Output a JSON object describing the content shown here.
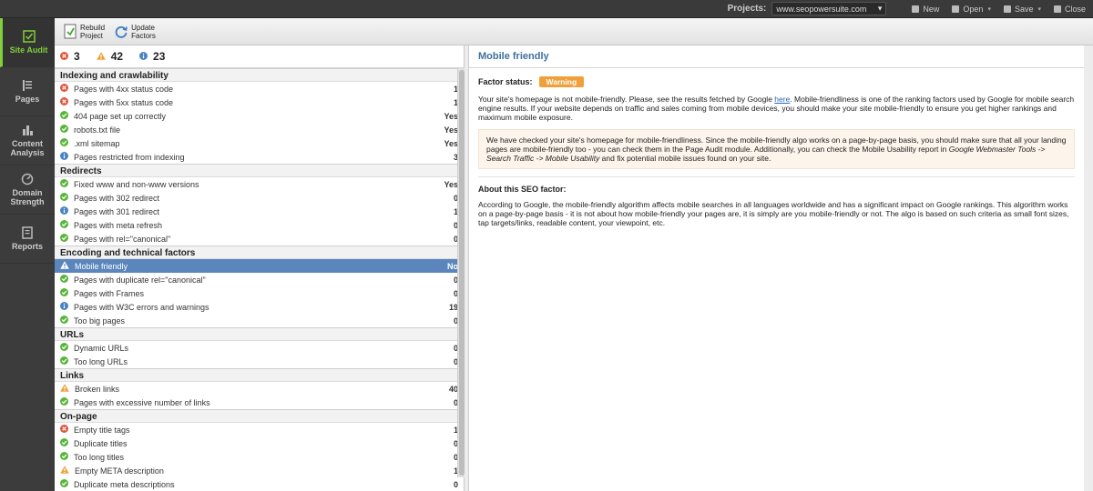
{
  "topbar": {
    "projects_label": "Projects:",
    "project_value": "www.seopowersuite.com",
    "new_label": "New",
    "open_label": "Open",
    "save_label": "Save",
    "close_label": "Close"
  },
  "sidebar": {
    "items": [
      {
        "label": "Site Audit"
      },
      {
        "label": "Pages"
      },
      {
        "label": "Content Analysis"
      },
      {
        "label": "Domain Strength"
      },
      {
        "label": "Reports"
      }
    ]
  },
  "toolbar": {
    "rebuild_line1": "Rebuild",
    "rebuild_line2": "Project",
    "update_line1": "Update",
    "update_line2": "Factors"
  },
  "summary": {
    "errors": "3",
    "warnings": "42",
    "info": "23"
  },
  "groups": [
    {
      "title": "Indexing and crawlability",
      "rows": [
        {
          "status": "error",
          "label": "Pages with 4xx status code",
          "value": "1"
        },
        {
          "status": "error",
          "label": "Pages with 5xx status code",
          "value": "1"
        },
        {
          "status": "ok",
          "label": "404 page set up correctly",
          "value": "Yes"
        },
        {
          "status": "ok",
          "label": "robots.txt file",
          "value": "Yes"
        },
        {
          "status": "ok",
          "label": ".xml sitemap",
          "value": "Yes"
        },
        {
          "status": "info",
          "label": "Pages restricted from indexing",
          "value": "3"
        }
      ]
    },
    {
      "title": "Redirects",
      "rows": [
        {
          "status": "ok",
          "label": "Fixed www and non-www versions",
          "value": "Yes"
        },
        {
          "status": "ok",
          "label": "Pages with 302 redirect",
          "value": "0"
        },
        {
          "status": "info",
          "label": "Pages with 301 redirect",
          "value": "1"
        },
        {
          "status": "ok",
          "label": "Pages with meta refresh",
          "value": "0"
        },
        {
          "status": "ok",
          "label": "Pages with rel=\"canonical\"",
          "value": "0"
        }
      ]
    },
    {
      "title": "Encoding and technical factors",
      "rows": [
        {
          "status": "warn",
          "label": "Mobile friendly",
          "value": "No",
          "selected": true
        },
        {
          "status": "ok",
          "label": "Pages with duplicate rel=\"canonical\"",
          "value": "0"
        },
        {
          "status": "ok",
          "label": "Pages with Frames",
          "value": "0"
        },
        {
          "status": "info",
          "label": "Pages with W3C errors and warnings",
          "value": "19"
        },
        {
          "status": "ok",
          "label": "Too big pages",
          "value": "0"
        }
      ]
    },
    {
      "title": "URLs",
      "rows": [
        {
          "status": "ok",
          "label": "Dynamic URLs",
          "value": "0"
        },
        {
          "status": "ok",
          "label": "Too long URLs",
          "value": "0"
        }
      ]
    },
    {
      "title": "Links",
      "rows": [
        {
          "status": "warn",
          "label": "Broken links",
          "value": "40"
        },
        {
          "status": "ok",
          "label": "Pages with excessive number of links",
          "value": "0"
        }
      ]
    },
    {
      "title": "On-page",
      "rows": [
        {
          "status": "error",
          "label": "Empty title tags",
          "value": "1"
        },
        {
          "status": "ok",
          "label": "Duplicate titles",
          "value": "0"
        },
        {
          "status": "ok",
          "label": "Too long titles",
          "value": "0"
        },
        {
          "status": "warn",
          "label": "Empty META description",
          "value": "1"
        },
        {
          "status": "ok",
          "label": "Duplicate meta descriptions",
          "value": "0"
        }
      ]
    }
  ],
  "detail": {
    "title": "Mobile friendly",
    "factor_status_label": "Factor status:",
    "factor_status_value": "Warning",
    "para1_a": "Your site's homepage is not mobile-friendly. Please, see the results fetched by Google ",
    "para1_link": "here",
    "para1_b": ". Mobile-friendliness is one of the ranking factors used by Google for mobile search engine results. If your website depends on traffic and sales coming from mobile devices, you should make your site mobile-friendly to ensure you get higher rankings and maximum mobile exposure.",
    "note_a": "We have checked your site's homepage for mobile-friendliness. Since the mobile-friendly algo works on a page-by-page basis, you should make sure that all your landing pages are mobile-friendly too - you can check them in the Page Audit module. Additionally, you can check the Mobile Usability report in ",
    "note_italic": "Google Webmaster Tools -> Search Traffic -> Mobile Usability",
    "note_b": " and fix potential mobile issues found on your site.",
    "about_title": "About this SEO factor:",
    "about_text": "According to Google, the mobile-friendly algorithm affects mobile searches in all languages worldwide and has a significant impact on Google rankings. This algorithm works on a page-by-page basis - it is not about how mobile-friendly your pages are, it is simply are you mobile-friendly or not. The algo is based on such criteria as small font sizes, tap targets/links, readable content, your viewpoint, etc."
  },
  "colors": {
    "ok": "#59b53a",
    "error": "#e2563b",
    "warn": "#f0a03a",
    "info": "#4a82c4",
    "accent": "#7fd03a",
    "selected": "#5b86bd"
  }
}
